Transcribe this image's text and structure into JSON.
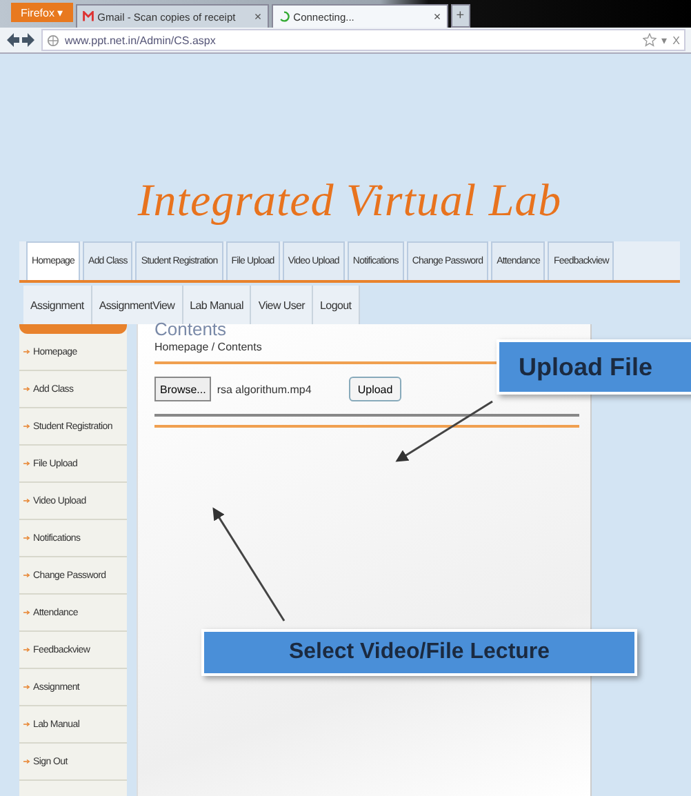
{
  "browser": {
    "menu_button": "Firefox ▾",
    "tabs": [
      {
        "kind": "mail",
        "title": "Gmail - Scan copies of receipt",
        "close": "×",
        "selected": false
      },
      {
        "kind": "loading",
        "title": "Connecting...",
        "close": "×",
        "selected": true
      }
    ],
    "new_tab": "+",
    "url": "www.ppt.net.in/Admin/CS.aspx",
    "bar_glyphs": [
      "▾",
      "X"
    ]
  },
  "site_title": "Integrated Virtual Lab",
  "nav_primary": [
    {
      "label": "Homepage",
      "selected": true
    },
    {
      "label": "Add Class",
      "selected": false
    },
    {
      "label": "Student Registration",
      "selected": false
    },
    {
      "label": "File Upload",
      "selected": false
    },
    {
      "label": "Video Upload",
      "selected": false
    },
    {
      "label": "Notifications",
      "selected": false
    },
    {
      "label": "Change Password",
      "selected": false
    },
    {
      "label": "Attendance",
      "selected": false
    },
    {
      "label": "Feedbackview",
      "selected": false
    }
  ],
  "nav_secondary": [
    {
      "label": "Assignment",
      "selected": false
    },
    {
      "label": "AssignmentView",
      "selected": false
    },
    {
      "label": "Lab Manual",
      "selected": false
    },
    {
      "label": "View User",
      "selected": false
    },
    {
      "label": "Logout",
      "selected": false
    }
  ],
  "sidebar": {
    "items": [
      "Homepage",
      "Add Class",
      "Student Registration",
      "File Upload",
      "Video Upload",
      "Notifications",
      "Change Password",
      "Attendance",
      "Feedbackview",
      "Assignment",
      "Lab Manual",
      "Sign Out"
    ]
  },
  "content": {
    "heading": "Contents",
    "breadcrumb": "Homepage / Contents",
    "browse_button": "Browse...",
    "file_name": "rsa algorithum.mp4",
    "upload_button": "Upload"
  },
  "callouts": [
    {
      "text": "Upload File"
    },
    {
      "text": "Select Video/File Lecture"
    }
  ]
}
